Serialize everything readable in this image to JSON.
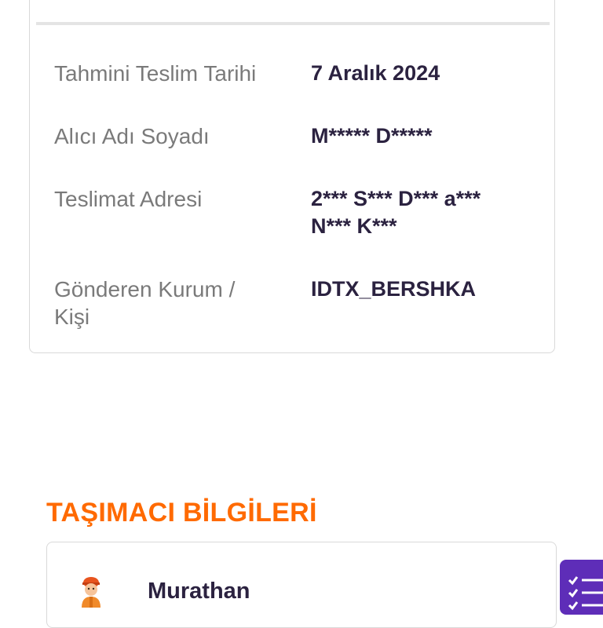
{
  "shipment_details": {
    "rows": [
      {
        "label": "Tahmini Teslim Tarihi",
        "value": "7 Aralık 2024"
      },
      {
        "label": "Alıcı Adı Soyadı",
        "value": "M***** D*****"
      },
      {
        "label": "Teslimat Adresi",
        "value_line1": "2*** S*** D*** a***",
        "value_line2": "N*** K***"
      },
      {
        "label_line1": "Gönderen Kurum /",
        "label_line2": "Kişi",
        "value": "IDTX_BERSHKA"
      }
    ]
  },
  "carrier_section": {
    "title": "TAŞIMACI BİLGİLERİ",
    "carrier_name": "Murathan",
    "icon": "courier-icon"
  },
  "fab": {
    "icon": "checklist-icon",
    "color": "#5e2db8"
  },
  "colors": {
    "accent": "#ff6a00",
    "label": "#7a7a7a",
    "value": "#2b2240"
  }
}
